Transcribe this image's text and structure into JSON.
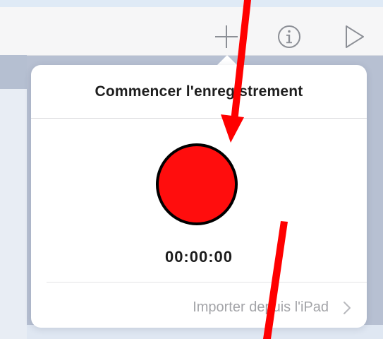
{
  "toolbar": {
    "icons": [
      "plus-icon",
      "info-icon",
      "play-icon"
    ]
  },
  "popover": {
    "title": "Commencer l'enregistrement",
    "timer": "00:00:00",
    "import_label": "Importer depuis l'iPad",
    "record_color": "#ff0d0d"
  },
  "annotations": {
    "arrow_color": "#ff0000",
    "arrows": [
      "red-arrow-down",
      "red-arrow-bottom"
    ]
  }
}
